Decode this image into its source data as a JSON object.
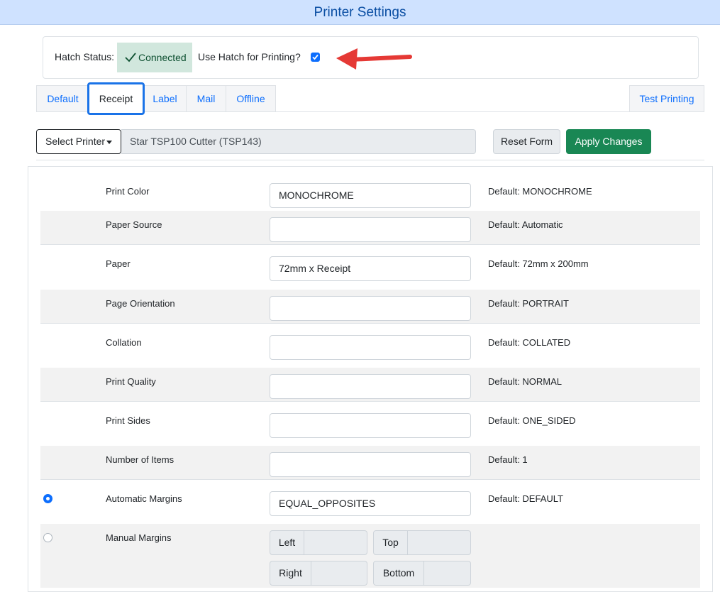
{
  "header": {
    "title": "Printer Settings"
  },
  "hatch": {
    "status_label": "Hatch Status:",
    "status_value": "Connected",
    "use_label": "Use Hatch for Printing?",
    "use_checked": true,
    "status_color": "#d1e7dd",
    "arrow_color": "#e53935"
  },
  "tabs": [
    {
      "label": "Default"
    },
    {
      "label": "Receipt",
      "active": true
    },
    {
      "label": "Label"
    },
    {
      "label": "Mail"
    },
    {
      "label": "Offline"
    },
    {
      "label": "Test Printing"
    }
  ],
  "printer": {
    "select_label": "Select Printer",
    "selected": "Star TSP100 Cutter (TSP143)",
    "reset_label": "Reset Form",
    "apply_label": "Apply Changes"
  },
  "settings": [
    {
      "label": "Print Color",
      "value": "MONOCHROME",
      "default": "Default: MONOCHROME"
    },
    {
      "label": "Paper Source",
      "value": "",
      "default": "Default: Automatic"
    },
    {
      "label": "Paper",
      "value": "72mm x Receipt",
      "default": "Default: 72mm x 200mm"
    },
    {
      "label": "Page Orientation",
      "value": "",
      "default": "Default: PORTRAIT"
    },
    {
      "label": "Collation",
      "value": "",
      "default": "Default: COLLATED"
    },
    {
      "label": "Print Quality",
      "value": "",
      "default": "Default: NORMAL"
    },
    {
      "label": "Print Sides",
      "value": "",
      "default": "Default: ONE_SIDED"
    },
    {
      "label": "Number of Items",
      "value": "",
      "default": "Default: 1"
    },
    {
      "label": "Automatic Margins",
      "value": "EQUAL_OPPOSITES",
      "default": "Default: DEFAULT",
      "radio_selected": true
    },
    {
      "label": "Manual Margins",
      "radio_selected": false
    }
  ],
  "manual_margins": {
    "left": "Left",
    "top": "Top",
    "right": "Right",
    "bottom": "Bottom"
  }
}
